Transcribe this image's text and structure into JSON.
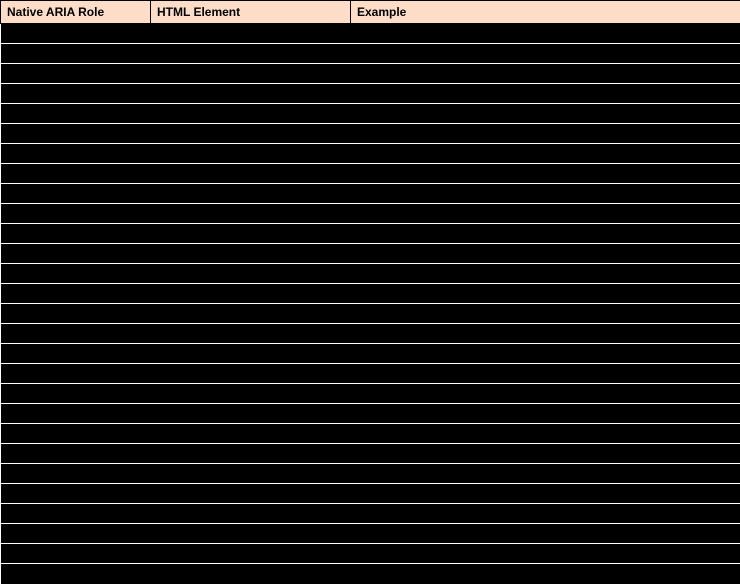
{
  "table": {
    "headers": [
      "Native ARIA Role",
      "HTML Element",
      "Example"
    ],
    "row_count": 28
  }
}
